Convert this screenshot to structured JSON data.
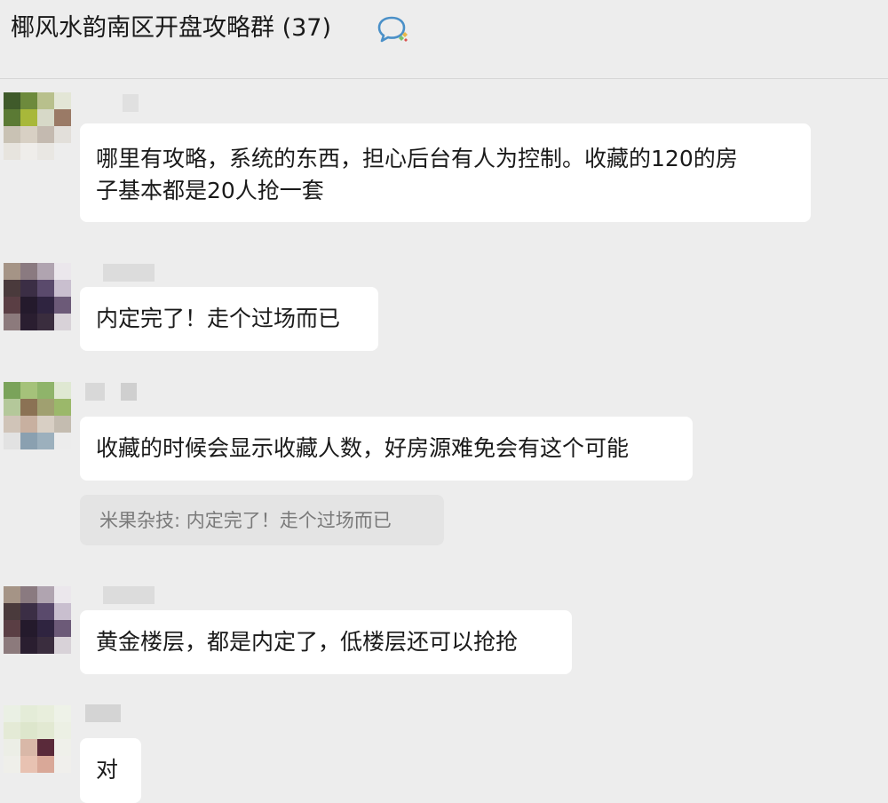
{
  "header": {
    "title": "椰风水韵南区开盘攻略群",
    "member_count": "(37)",
    "icon": "chat-bubble-icon"
  },
  "messages": [
    {
      "lines": [
        "哪里有攻略，系统的东西，担心后台有人为控制。收藏的120的房",
        "子基本都是20人抢一套"
      ]
    },
    {
      "lines": [
        "内定完了！走个过场而已"
      ]
    },
    {
      "lines": [
        "收藏的时候会显示收藏人数，好房源难免会有这个可能"
      ],
      "quote": "米果杂技: 内定完了！走个过场而已"
    },
    {
      "lines": [
        "黄金楼层，都是内定了，低楼层还可以抢抢"
      ]
    },
    {
      "lines": [
        "对"
      ]
    }
  ]
}
